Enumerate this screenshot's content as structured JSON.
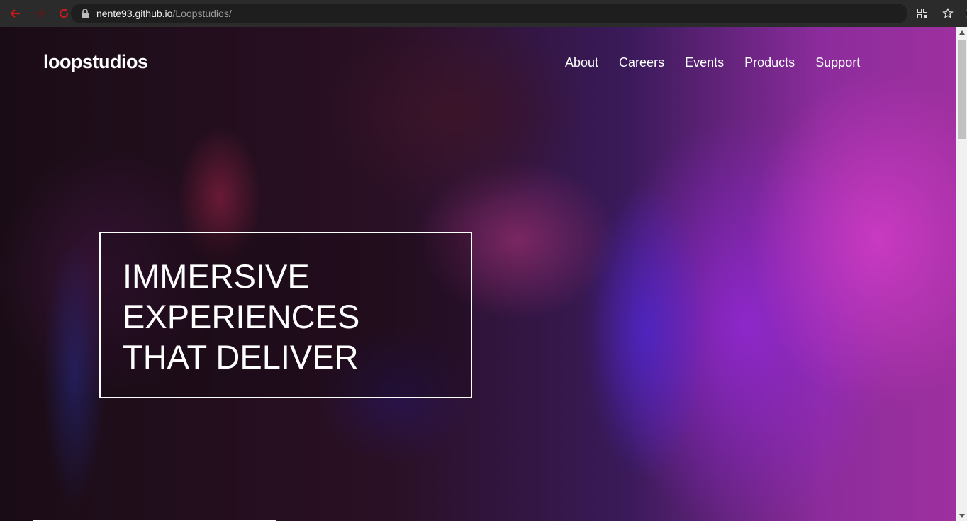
{
  "browser": {
    "url_host": "nente93.github.io",
    "url_path": "/Loopstudios/"
  },
  "site": {
    "logo": "loopstudios",
    "nav": [
      "About",
      "Careers",
      "Events",
      "Products",
      "Support"
    ],
    "hero_lines": [
      "IMMERSIVE",
      "EXPERIENCES",
      "THAT DELIVER"
    ]
  },
  "colors": {
    "accent_red": "#d41515",
    "chrome_bg": "#2b2b2b",
    "omnibox_bg": "#1e1e1e",
    "hero_border": "#ffffff"
  },
  "icons": {
    "back": "back-arrow-icon",
    "forward": "forward-arrow-icon",
    "reload": "reload-icon",
    "lock": "lock-icon",
    "qr": "qr-code-icon",
    "star": "star-icon",
    "menu": "kebab-menu-icon"
  }
}
